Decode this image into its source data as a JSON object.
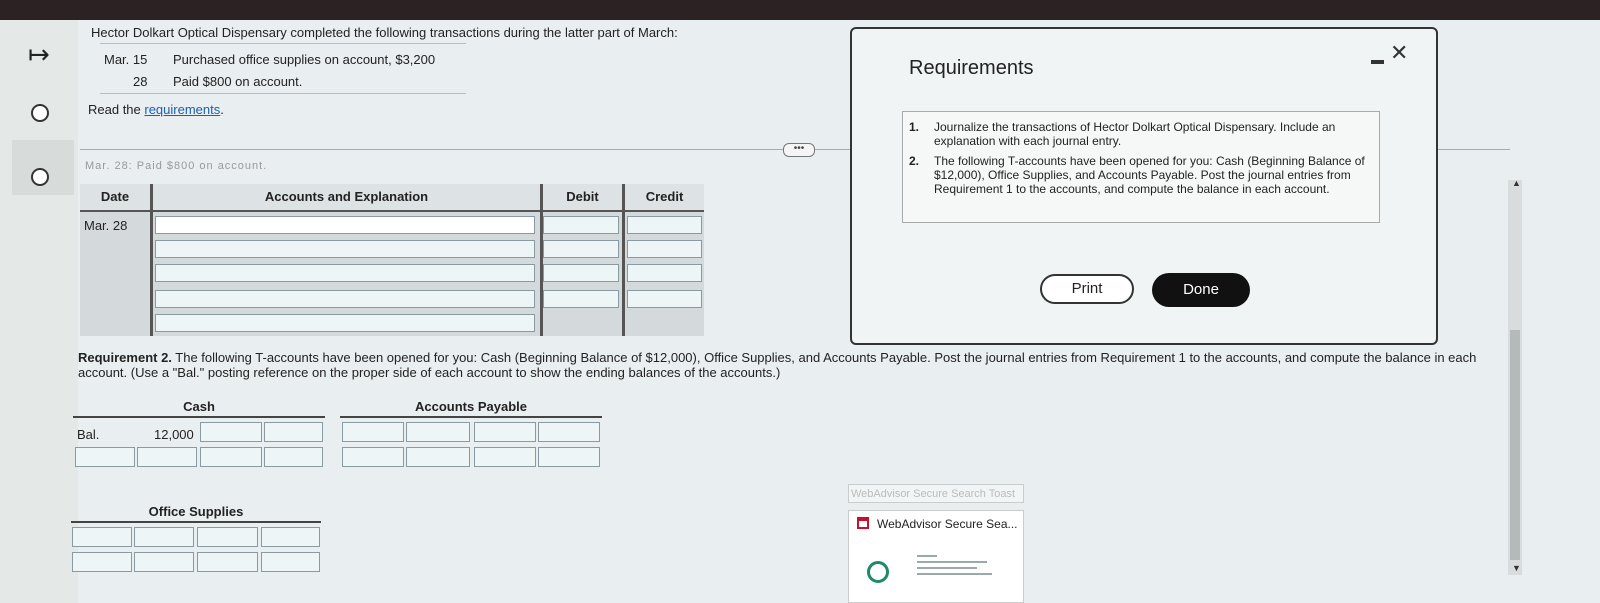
{
  "problem": {
    "intro": "Hector Dolkart Optical Dispensary completed the following transactions during the latter part of March:",
    "transactions": [
      {
        "date": "Mar. 15",
        "description": "Purchased office supplies on account, $3,200"
      },
      {
        "date": "28",
        "description": "Paid $800 on account."
      }
    ],
    "read_prefix": "Read the ",
    "read_link": "requirements",
    "read_suffix": "."
  },
  "journal": {
    "faded_header": "Mar. 28: Paid $800 on account.",
    "headers": {
      "date": "Date",
      "accounts": "Accounts and Explanation",
      "debit": "Debit",
      "credit": "Credit"
    },
    "date_value": "Mar. 28"
  },
  "requirement2": {
    "label": "Requirement 2.",
    "text": " The following T-accounts have been opened for you: Cash (Beginning Balance of $12,000), Office Supplies, and Accounts Payable. Post the journal entries from Requirement 1 to the accounts, and compute the balance in each account. (Use a \"Bal.\" posting reference on the proper side of each account to show the ending balances of the accounts.)"
  },
  "taccounts": {
    "cash": {
      "title": "Cash",
      "bal_label": "Bal.",
      "bal_value": "12,000"
    },
    "accounts_payable": {
      "title": "Accounts Payable"
    },
    "office_supplies": {
      "title": "Office Supplies"
    }
  },
  "modal": {
    "title": "Requirements",
    "requirements": [
      {
        "num": "1.",
        "text": "Journalize the transactions of Hector Dolkart Optical Dispensary. Include an explanation with each journal entry."
      },
      {
        "num": "2.",
        "text": "The following T-accounts have been opened for you: Cash (Beginning Balance of $12,000), Office Supplies, and Accounts Payable. Post the journal entries from Requirement 1 to the accounts, and compute the balance in each account."
      }
    ],
    "print_label": "Print",
    "done_label": "Done"
  },
  "webadvisor": {
    "ghost_text": "WebAdvisor Secure Search Toast",
    "toast_title": "WebAdvisor Secure Sea..."
  },
  "colors": {
    "accent_link": "#1a5fb4",
    "done_button": "#111111",
    "webadvisor_red": "#c8102e"
  }
}
